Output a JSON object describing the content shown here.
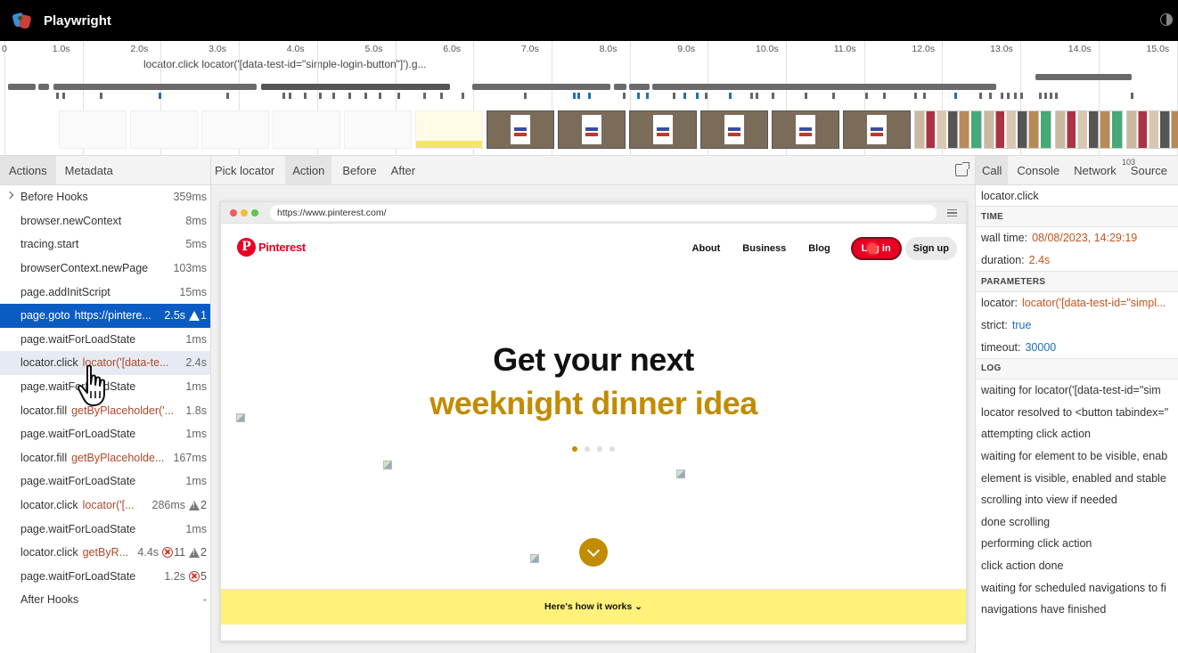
{
  "app": {
    "title": "Playwright"
  },
  "timeline": {
    "ticks": [
      "0",
      "1.0s",
      "2.0s",
      "3.0s",
      "4.0s",
      "5.0s",
      "6.0s",
      "7.0s",
      "8.0s",
      "9.0s",
      "10.0s",
      "11.0s",
      "12.0s",
      "13.0s",
      "14.0s",
      "15.0s"
    ],
    "hover_label": "locator.click locator('[data-test-id=\"simple-login-button\"]').g..."
  },
  "left": {
    "tabs": [
      "Actions",
      "Metadata"
    ],
    "actions": [
      {
        "name": "Before Hooks",
        "arg": "",
        "duration": "359ms"
      },
      {
        "name": "browser.newContext",
        "arg": "",
        "duration": "8ms"
      },
      {
        "name": "tracing.start",
        "arg": "",
        "duration": "5ms"
      },
      {
        "name": "browserContext.newPage",
        "arg": "",
        "duration": "103ms"
      },
      {
        "name": "page.addInitScript",
        "arg": "",
        "duration": "15ms"
      },
      {
        "name": "page.goto",
        "arg": "https://pintere...",
        "duration": "2.5s",
        "warnings": "1"
      },
      {
        "name": "page.waitForLoadState",
        "arg": "",
        "duration": "1ms"
      },
      {
        "name": "locator.click",
        "arg": "locator('[data-te...",
        "duration": "2.4s"
      },
      {
        "name": "page.waitForLoadState",
        "arg": "",
        "duration": "1ms"
      },
      {
        "name": "locator.fill",
        "arg": "getByPlaceholder('...",
        "duration": "1.8s"
      },
      {
        "name": "page.waitForLoadState",
        "arg": "",
        "duration": "1ms"
      },
      {
        "name": "locator.fill",
        "arg": "getByPlaceholde...",
        "duration": "167ms"
      },
      {
        "name": "page.waitForLoadState",
        "arg": "",
        "duration": "1ms"
      },
      {
        "name": "locator.click",
        "arg": "locator('[...",
        "duration": "286ms",
        "warnings": "2"
      },
      {
        "name": "page.waitForLoadState",
        "arg": "",
        "duration": "1ms"
      },
      {
        "name": "locator.click",
        "arg": "getByR...",
        "duration": "4.4s",
        "errors": "11",
        "warnings": "2"
      },
      {
        "name": "page.waitForLoadState",
        "arg": "",
        "duration": "1.2s",
        "errors": "5"
      },
      {
        "name": "After Hooks",
        "arg": "",
        "duration": "-"
      }
    ]
  },
  "center": {
    "tabs": [
      "Pick locator",
      "Action",
      "Before",
      "After"
    ],
    "snapshot": {
      "url": "https://www.pinterest.com/",
      "brand": "Pinterest",
      "brand_mark": "P",
      "nav": [
        "About",
        "Business",
        "Blog"
      ],
      "login_label": "Log in",
      "signup_label": "Sign up",
      "headline_1": "Get your next",
      "headline_2": "weeknight dinner idea",
      "footer_cta": "Here's how it works",
      "pager_dots": 4,
      "pager_active": 1
    }
  },
  "right": {
    "tabs": [
      "Call",
      "Console",
      "Network",
      "Source"
    ],
    "network_count": "103",
    "call_title": "locator.click",
    "time_header": "TIME",
    "wall_time_label": "wall time:",
    "wall_time": "08/08/2023, 14:29:19",
    "duration_label": "duration:",
    "duration": "2.4s",
    "params_header": "PARAMETERS",
    "locator_label": "locator:",
    "locator_value": "locator('[data-test-id=\"simpl...",
    "strict_label": "strict:",
    "strict_value": "true",
    "timeout_label": "timeout:",
    "timeout_value": "30000",
    "log_header": "LOG",
    "log": [
      "waiting for locator('[data-test-id=\"sim",
      "locator resolved to <button tabindex=\"",
      "attempting click action",
      "waiting for element to be visible, enab",
      "element is visible, enabled and stable",
      "scrolling into view if needed",
      "done scrolling",
      "performing click action",
      "click action done",
      "waiting for scheduled navigations to fi",
      "navigations have finished"
    ]
  },
  "colors": {
    "selected_row": "#0b5cc2",
    "pinterest_red": "#e60023",
    "headline_gold": "#c28b00",
    "cta_yellow": "#fff27a",
    "value_orange": "#c0541e",
    "value_blue": "#1f6fb5"
  },
  "icons": [
    "playwright-logo-icon",
    "theme-toggle-icon",
    "chevron-right-icon",
    "warning-icon",
    "error-icon",
    "popout-icon",
    "hamburger-menu-icon",
    "pinterest-logo-icon",
    "chevron-down-icon",
    "hand-cursor-icon"
  ]
}
